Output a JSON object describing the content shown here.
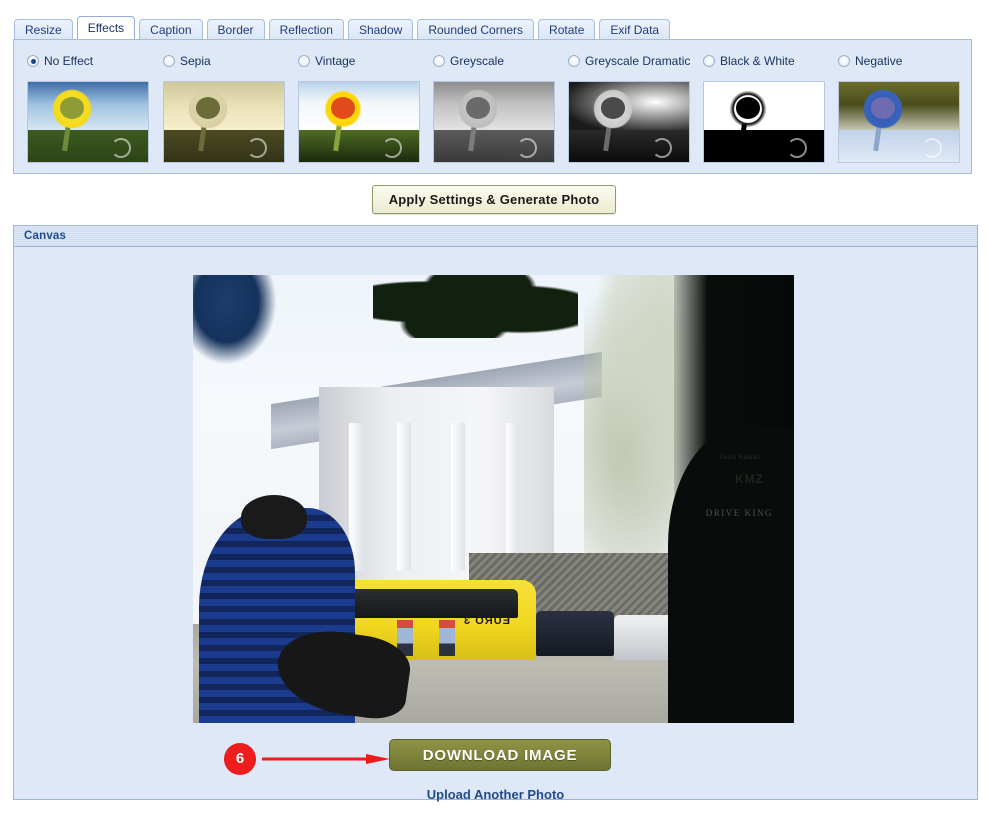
{
  "tabs": [
    {
      "label": "Resize",
      "active": false
    },
    {
      "label": "Effects",
      "active": true
    },
    {
      "label": "Caption",
      "active": false
    },
    {
      "label": "Border",
      "active": false
    },
    {
      "label": "Reflection",
      "active": false
    },
    {
      "label": "Shadow",
      "active": false
    },
    {
      "label": "Rounded Corners",
      "active": false
    },
    {
      "label": "Rotate",
      "active": false
    },
    {
      "label": "Exif Data",
      "active": false
    }
  ],
  "effects": {
    "options": [
      {
        "label": "No Effect",
        "selected": true,
        "thumb": "sunflower-no-effect"
      },
      {
        "label": "Sepia",
        "selected": false,
        "thumb": "sunflower-sepia"
      },
      {
        "label": "Vintage",
        "selected": false,
        "thumb": "sunflower-vintage"
      },
      {
        "label": "Greyscale",
        "selected": false,
        "thumb": "sunflower-greyscale"
      },
      {
        "label": "Greyscale Dramatic",
        "selected": false,
        "thumb": "sunflower-greyscale-dramatic"
      },
      {
        "label": "Black & White",
        "selected": false,
        "thumb": "sunflower-black-and-white"
      },
      {
        "label": "Negative",
        "selected": false,
        "thumb": "sunflower-negative"
      }
    ]
  },
  "apply_button": {
    "label": "Apply Settings & Generate Photo"
  },
  "canvas": {
    "header_title": "Canvas",
    "photo": {
      "alt": "Street scene with man in blue striped shirt, yellow bus and building",
      "bus_text": "EURO 3",
      "vehicle_brand": "KMZ",
      "vehicle_brand_sub": "Setia Kawan",
      "vehicle_tagline": "DRIVE KING"
    }
  },
  "download": {
    "marker_number": "6",
    "button_label": "DOWNLOAD IMAGE",
    "upload_link_label": "Upload Another Photo"
  },
  "colors": {
    "panel_bg": "#dfe8f6",
    "panel_border": "#a6bcdd",
    "accent_text": "#1f4b8e",
    "marker_red": "#ee1c1c",
    "download_green": "#80853c",
    "apply_cream": "#f3f3df"
  }
}
